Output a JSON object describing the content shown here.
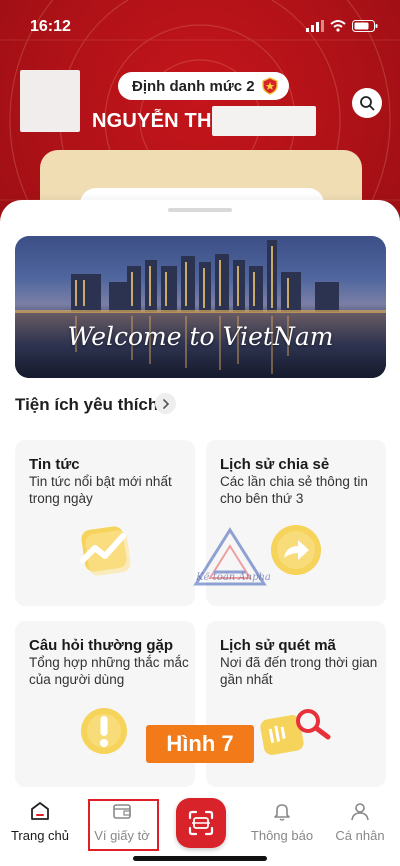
{
  "status_bar": {
    "time": "16:12"
  },
  "header": {
    "level_label": "Định danh mức 2",
    "user_name": "NGUYỄN THỊ"
  },
  "banner": {
    "caption": "Welcome to VietNam"
  },
  "favorites": {
    "title": "Tiện ích yêu thích",
    "tiles": [
      {
        "title": "Tin tức",
        "desc": "Tin tức nổi bật mới nhất trong ngày",
        "icon": "news-chart-icon"
      },
      {
        "title": "Lịch sử chia sẻ",
        "desc": "Các lần chia sẻ thông tin cho bên thứ 3",
        "icon": "share-arrow-icon"
      },
      {
        "title": "Câu hỏi thường gặp",
        "desc": "Tổng hợp những thắc mắc của người dùng",
        "icon": "exclamation-icon"
      },
      {
        "title": "Lịch sử quét mã",
        "desc": "Nơi đã đến trong thời gian gần nhất",
        "icon": "scan-search-icon"
      }
    ]
  },
  "watermark": {
    "text": "Kế toán Anpha"
  },
  "figure_label": "Hình 7",
  "bottom_nav": {
    "items": [
      {
        "label": "Trang chủ",
        "icon": "home-icon"
      },
      {
        "label": "Ví giấy tờ",
        "icon": "wallet-icon"
      },
      {
        "label": "",
        "icon": "scan-qr-icon"
      },
      {
        "label": "Thông báo",
        "icon": "bell-icon"
      },
      {
        "label": "Cá nhân",
        "icon": "person-icon"
      }
    ]
  },
  "colors": {
    "brand_red": "#c4151b",
    "gold": "#f0ddb4",
    "highlight_orange": "#f37a18",
    "icon_yellow": "#f6d35a"
  }
}
